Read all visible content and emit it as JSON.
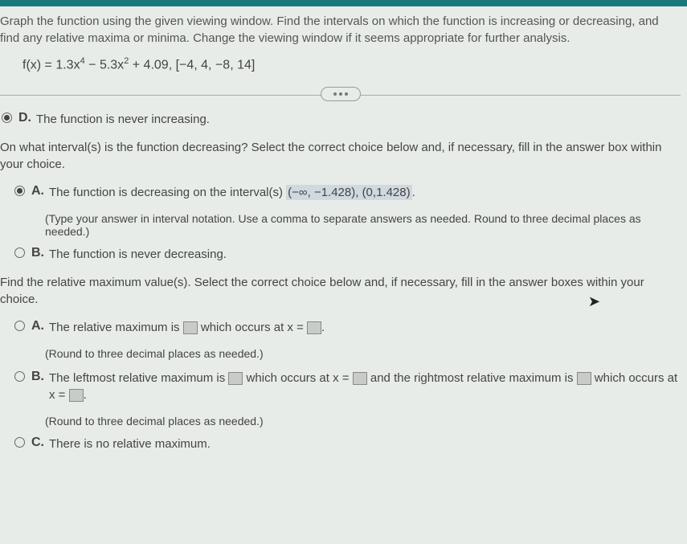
{
  "instructions": "Graph the function using the given viewing window. Find the intervals on which the function is increasing or decreasing, and find any relative maxima or minima. Change the viewing window if it seems appropriate for further analysis.",
  "formula_prefix": "f(x) = 1.3x",
  "formula_exp1": "4",
  "formula_mid": " − 5.3x",
  "formula_exp2": "2",
  "formula_suffix": " + 4.09, [−4, 4, −8, 14]",
  "optD_label": "D.",
  "optD_text": "The function is never increasing.",
  "q1": "On what interval(s) is the function decreasing? Select the correct choice below and, if necessary, fill in the answer box within your choice.",
  "q1_optA_label": "A.",
  "q1_optA_text1": "The function is decreasing on the interval(s) ",
  "q1_optA_answer": "(−∞, −1.428), (0,1.428)",
  "q1_optA_text2": ".",
  "q1_optA_hint": "(Type your answer in interval notation. Use a comma to separate answers as needed. Round to three decimal places as needed.)",
  "q1_optB_label": "B.",
  "q1_optB_text": "The function is never decreasing.",
  "q2": "Find the relative maximum value(s). Select the correct choice below and, if necessary, fill in the answer boxes within your choice.",
  "q2_optA_label": "A.",
  "q2_optA_text1": "The relative maximum is ",
  "q2_optA_text2": " which occurs at x = ",
  "q2_optA_text3": ".",
  "q2_optA_hint": "(Round to three decimal places as needed.)",
  "q2_optB_label": "B.",
  "q2_optB_text1": "The leftmost relative maximum is ",
  "q2_optB_text2": " which occurs at x = ",
  "q2_optB_text3": " and the rightmost relative maximum is ",
  "q2_optB_text4": " which occurs at x = ",
  "q2_optB_text5": ".",
  "q2_optB_hint": "(Round to three decimal places as needed.)",
  "q2_optC_label": "C.",
  "q2_optC_text": "There is no relative maximum."
}
